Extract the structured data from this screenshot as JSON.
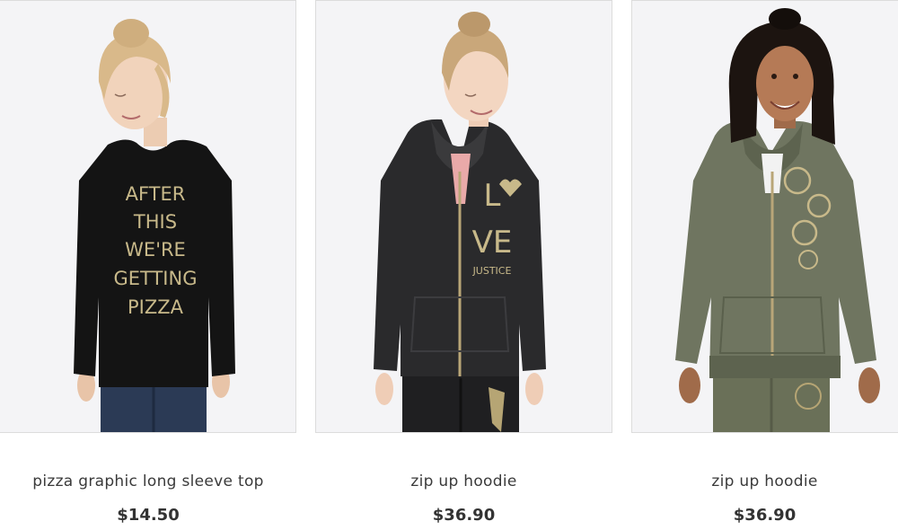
{
  "products": [
    {
      "name": "pizza graphic long sleeve top",
      "price": "$14.50",
      "print_lines": [
        "AFTER",
        "THIS",
        "WE'RE",
        "GETTING",
        "PIZZA"
      ],
      "colors": {
        "garment": "#141414",
        "hair": "#d9b98a",
        "print": "#c8b98a"
      }
    },
    {
      "name": "zip up hoodie",
      "price": "$36.90",
      "print_lines": [
        "L",
        "VE",
        "JUSTICE"
      ],
      "colors": {
        "garment": "#2a2a2c",
        "hair": "#c9a77a",
        "print": "#c8b98a"
      }
    },
    {
      "name": "zip up hoodie",
      "price": "$36.90",
      "print_lines": [],
      "colors": {
        "garment": "#6f7560",
        "hair": "#1c1410",
        "print": "#c8b98a"
      }
    }
  ],
  "background": "#f4f4f6"
}
